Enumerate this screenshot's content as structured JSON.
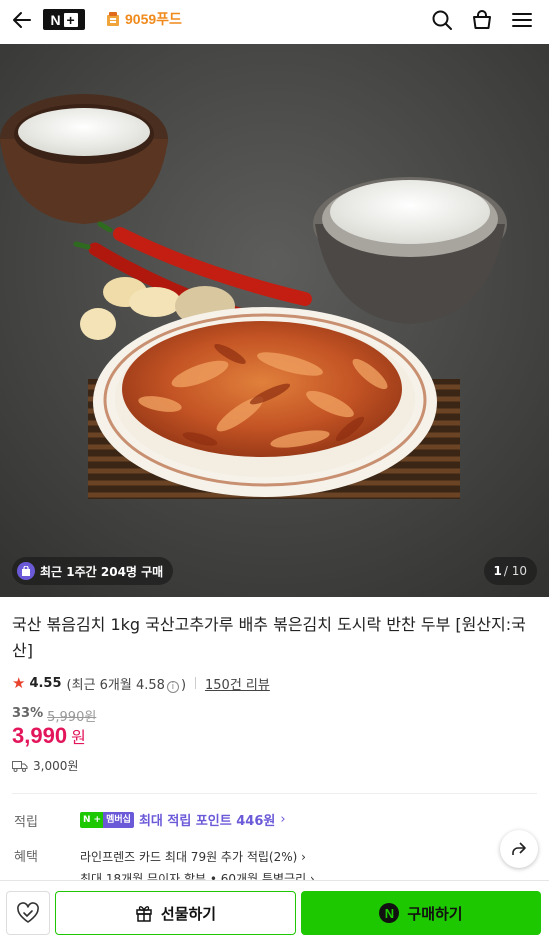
{
  "header": {
    "logo_n": "N",
    "logo_plus": "+",
    "store_name": "9059푸드",
    "icons": [
      "back-arrow-icon",
      "search-icon",
      "shopping-bag-icon",
      "menu-icon"
    ]
  },
  "hero": {
    "recent_purchase": "최근 1주간 204명 구매",
    "image_index": "1",
    "image_total": "/ 10"
  },
  "product": {
    "title": "국산 볶음김치 1kg 국산고추가루 배추 볶은김치 도시락 반찬 두부 [원산지:국산]",
    "rating": "4.55",
    "recent_rating_prefix": "(최근 6개월 4.58",
    "recent_rating_suffix": ")",
    "info_mark": "i",
    "review_count": "150건 리뷰",
    "discount": "33%",
    "original_price": "5,990원",
    "price": "3,990",
    "currency": "원",
    "shipping_fee": "3,000원"
  },
  "points": {
    "label": "적립",
    "membership_n": "N",
    "membership_plus": "+",
    "membership_text": "멤버십",
    "text": "최대 적립 포인트 446원",
    "arrow": "›"
  },
  "benefits": {
    "label": "혜택",
    "line1": "라인프렌즈 카드 최대 79원 추가 적립(2%) ›",
    "line2": "최대 18개월 무이자 할부 • 60개월 특별금리 ›"
  },
  "bottom_bar": {
    "gift_label": "선물하기",
    "buy_label": "구매하기",
    "buy_icon_letter": "N"
  },
  "colors": {
    "naver_green": "#1ec800",
    "price_red": "#e3165b",
    "membership_purple": "#6b5ad8",
    "store_orange": "#f08a1c"
  }
}
